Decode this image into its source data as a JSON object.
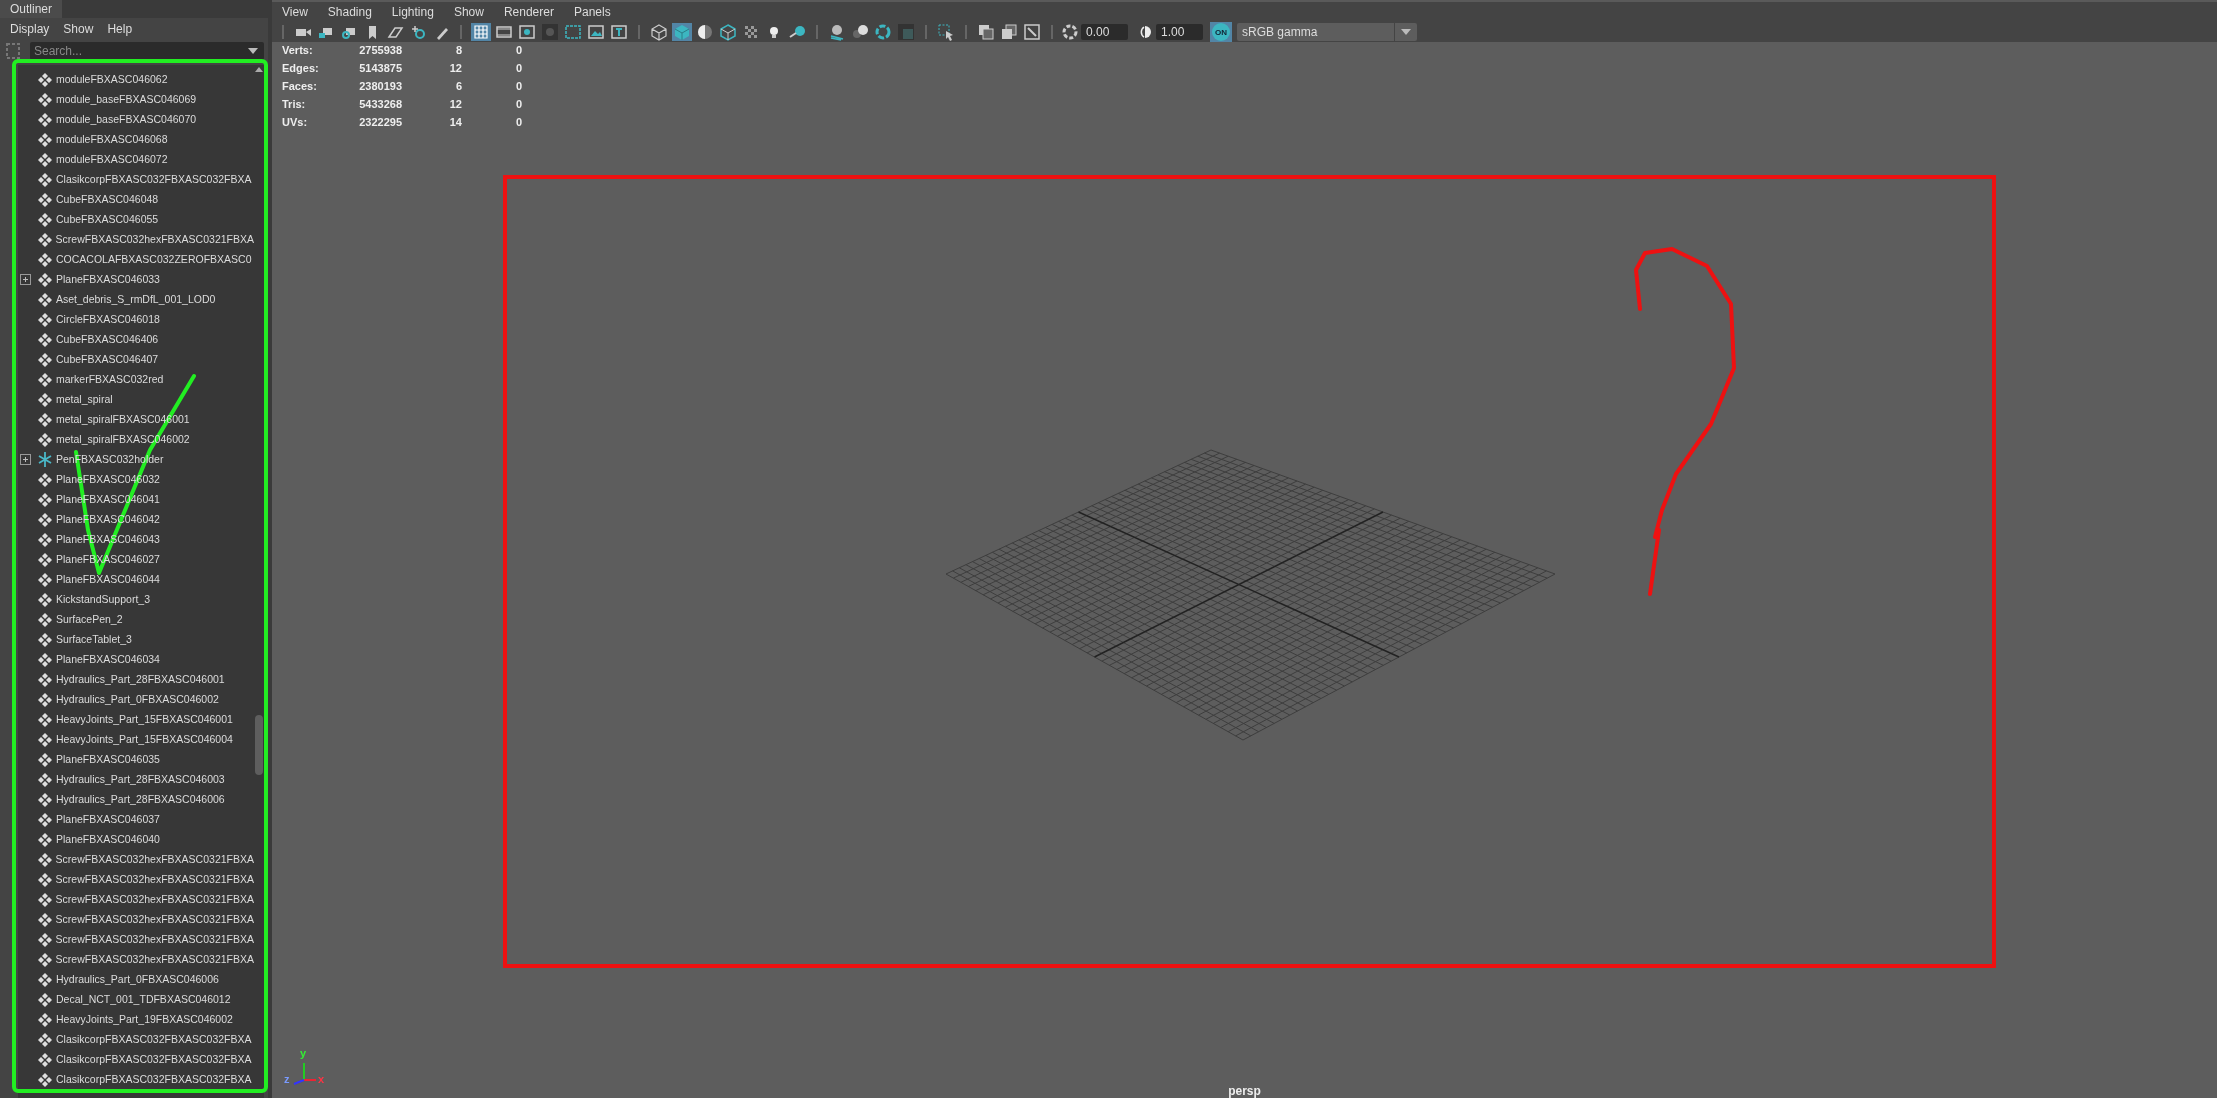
{
  "outliner": {
    "tab": "Outliner",
    "menu": [
      "Display",
      "Show",
      "Help"
    ],
    "search": {
      "placeholder": "Search..."
    },
    "items": [
      {
        "label": "moduleFBXASC046062",
        "kind": "mesh",
        "collapsed": false
      },
      {
        "label": "module_baseFBXASC046069",
        "kind": "mesh",
        "collapsed": false
      },
      {
        "label": "module_baseFBXASC046070",
        "kind": "mesh",
        "collapsed": false
      },
      {
        "label": "moduleFBXASC046068",
        "kind": "mesh",
        "collapsed": false
      },
      {
        "label": "moduleFBXASC046072",
        "kind": "mesh",
        "collapsed": false
      },
      {
        "label": "ClasikcorpFBXASC032FBXASC032FBXA",
        "kind": "mesh",
        "collapsed": false
      },
      {
        "label": "CubeFBXASC046048",
        "kind": "mesh",
        "collapsed": false
      },
      {
        "label": "CubeFBXASC046055",
        "kind": "mesh",
        "collapsed": false
      },
      {
        "label": "ScrewFBXASC032hexFBXASC0321FBXA",
        "kind": "mesh",
        "collapsed": false
      },
      {
        "label": "COCACOLAFBXASC032ZEROFBXASC0",
        "kind": "mesh",
        "collapsed": false
      },
      {
        "label": "PlaneFBXASC046033",
        "kind": "mesh",
        "collapsed": true
      },
      {
        "label": "Aset_debris_S_rmDfL_001_LOD0",
        "kind": "mesh",
        "collapsed": false
      },
      {
        "label": "CircleFBXASC046018",
        "kind": "mesh",
        "collapsed": false
      },
      {
        "label": "CubeFBXASC046406",
        "kind": "mesh",
        "collapsed": false
      },
      {
        "label": "CubeFBXASC046407",
        "kind": "mesh",
        "collapsed": false
      },
      {
        "label": "markerFBXASC032red",
        "kind": "mesh",
        "collapsed": false
      },
      {
        "label": "metal_spiral",
        "kind": "mesh",
        "collapsed": false
      },
      {
        "label": "metal_spiralFBXASC046001",
        "kind": "mesh",
        "collapsed": false
      },
      {
        "label": "metal_spiralFBXASC046002",
        "kind": "mesh",
        "collapsed": false
      },
      {
        "label": "PenFBXASC032holder",
        "kind": "locator",
        "collapsed": true
      },
      {
        "label": "PlaneFBXASC046032",
        "kind": "mesh",
        "collapsed": false
      },
      {
        "label": "PlaneFBXASC046041",
        "kind": "mesh",
        "collapsed": false
      },
      {
        "label": "PlaneFBXASC046042",
        "kind": "mesh",
        "collapsed": false
      },
      {
        "label": "PlaneFBXASC046043",
        "kind": "mesh",
        "collapsed": false
      },
      {
        "label": "PlaneFBXASC046027",
        "kind": "mesh",
        "collapsed": false
      },
      {
        "label": "PlaneFBXASC046044",
        "kind": "mesh",
        "collapsed": false
      },
      {
        "label": "KickstandSupport_3",
        "kind": "mesh",
        "collapsed": false
      },
      {
        "label": "SurfacePen_2",
        "kind": "mesh",
        "collapsed": false
      },
      {
        "label": "SurfaceTablet_3",
        "kind": "mesh",
        "collapsed": false
      },
      {
        "label": "PlaneFBXASC046034",
        "kind": "mesh",
        "collapsed": false
      },
      {
        "label": "Hydraulics_Part_28FBXASC046001",
        "kind": "mesh",
        "collapsed": false
      },
      {
        "label": "Hydraulics_Part_0FBXASC046002",
        "kind": "mesh",
        "collapsed": false
      },
      {
        "label": "HeavyJoints_Part_15FBXASC046001",
        "kind": "mesh",
        "collapsed": false
      },
      {
        "label": "HeavyJoints_Part_15FBXASC046004",
        "kind": "mesh",
        "collapsed": false
      },
      {
        "label": "PlaneFBXASC046035",
        "kind": "mesh",
        "collapsed": false
      },
      {
        "label": "Hydraulics_Part_28FBXASC046003",
        "kind": "mesh",
        "collapsed": false
      },
      {
        "label": "Hydraulics_Part_28FBXASC046006",
        "kind": "mesh",
        "collapsed": false
      },
      {
        "label": "PlaneFBXASC046037",
        "kind": "mesh",
        "collapsed": false
      },
      {
        "label": "PlaneFBXASC046040",
        "kind": "mesh",
        "collapsed": false
      },
      {
        "label": "ScrewFBXASC032hexFBXASC0321FBXA",
        "kind": "mesh",
        "collapsed": false
      },
      {
        "label": "ScrewFBXASC032hexFBXASC0321FBXA",
        "kind": "mesh",
        "collapsed": false
      },
      {
        "label": "ScrewFBXASC032hexFBXASC0321FBXA",
        "kind": "mesh",
        "collapsed": false
      },
      {
        "label": "ScrewFBXASC032hexFBXASC0321FBXA",
        "kind": "mesh",
        "collapsed": false
      },
      {
        "label": "ScrewFBXASC032hexFBXASC0321FBXA",
        "kind": "mesh",
        "collapsed": false
      },
      {
        "label": "ScrewFBXASC032hexFBXASC0321FBXA",
        "kind": "mesh",
        "collapsed": false
      },
      {
        "label": "Hydraulics_Part_0FBXASC046006",
        "kind": "mesh",
        "collapsed": false
      },
      {
        "label": "Decal_NCT_001_TDFBXASC046012",
        "kind": "mesh",
        "collapsed": false
      },
      {
        "label": "HeavyJoints_Part_19FBXASC046002",
        "kind": "mesh",
        "collapsed": false
      },
      {
        "label": "ClasikcorpFBXASC032FBXASC032FBXA",
        "kind": "mesh",
        "collapsed": false
      },
      {
        "label": "ClasikcorpFBXASC032FBXASC032FBXA",
        "kind": "mesh",
        "collapsed": false
      },
      {
        "label": "ClasikcorpFBXASC032FBXASC032FBXA",
        "kind": "mesh",
        "collapsed": false
      }
    ]
  },
  "viewport": {
    "menu": [
      "View",
      "Shading",
      "Lighting",
      "Show",
      "Renderer",
      "Panels"
    ],
    "toolbar": {
      "buttons": [
        {
          "selected": false
        },
        {
          "selected": false
        },
        {
          "selected": false
        },
        {
          "selected": false
        },
        {
          "selected": false
        },
        {
          "selected": false
        },
        {
          "selected": false
        },
        {
          "selected": true
        },
        {
          "selected": false
        },
        {
          "selected": false
        },
        {
          "selected": false
        },
        {
          "selected": false
        },
        {
          "selected": false
        },
        {
          "selected": false
        },
        {
          "selected": false
        },
        {
          "selected": true
        },
        {
          "selected": false
        },
        {
          "selected": false
        },
        {
          "selected": false
        },
        {
          "selected": false
        },
        {
          "selected": false
        },
        {
          "selected": false
        },
        {
          "selected": false
        },
        {
          "selected": false
        },
        {
          "selected": false
        },
        {
          "selected": false
        },
        {
          "selected": false
        },
        {
          "selected": false
        },
        {
          "selected": false
        }
      ],
      "exposure": "0.00",
      "gamma": "1.00",
      "color_management": {
        "on": true,
        "label": "ON"
      },
      "view_transform": "sRGB gamma"
    },
    "hud": [
      {
        "label": "Verts:",
        "values": [
          "2755938",
          "8",
          "0"
        ]
      },
      {
        "label": "Edges:",
        "values": [
          "5143875",
          "12",
          "0"
        ]
      },
      {
        "label": "Faces:",
        "values": [
          "2380193",
          "6",
          "0"
        ]
      },
      {
        "label": "Tris:",
        "values": [
          "5433268",
          "12",
          "0"
        ]
      },
      {
        "label": "UVs:",
        "values": [
          "2322295",
          "14",
          "0"
        ]
      }
    ],
    "axis": {
      "x": "x",
      "y": "y",
      "z": "z"
    },
    "camera": "persp"
  }
}
